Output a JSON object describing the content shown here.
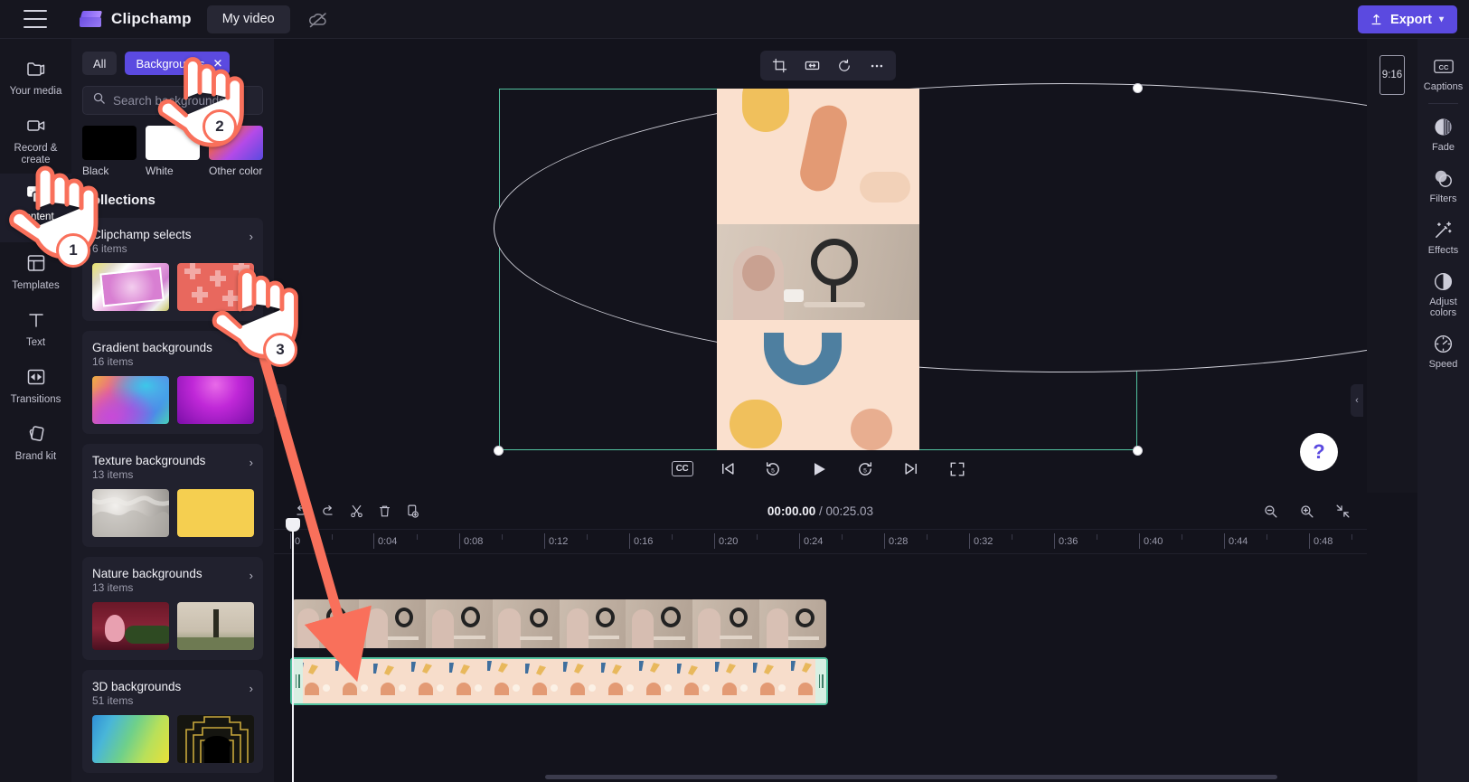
{
  "topbar": {
    "menu_icon": "hamburger-menu-icon",
    "logo_icon": "clipchamp-logo-icon",
    "app_name": "Clipchamp",
    "project_name": "My video",
    "cloud_icon": "cloud-offline-icon",
    "export_label": "Export",
    "export_caret": "⌄",
    "accent_color": "#5b4ae0"
  },
  "left_rail": {
    "items": [
      {
        "label": "Your media",
        "icon": "folder-icon",
        "active": false
      },
      {
        "label": "Record & create",
        "icon": "video-camera-icon",
        "active": false
      },
      {
        "label": "Content library",
        "icon": "content-library-icon",
        "active": true
      },
      {
        "label": "Templates",
        "icon": "templates-icon",
        "active": false
      },
      {
        "label": "Text",
        "icon": "text-icon",
        "active": false
      },
      {
        "label": "Transitions",
        "icon": "transitions-icon",
        "active": false
      },
      {
        "label": "Brand kit",
        "icon": "brand-kit-icon",
        "active": false
      }
    ]
  },
  "library_panel": {
    "filter_chips": [
      {
        "label": "All",
        "selected": false
      },
      {
        "label": "Backgrounds",
        "selected": true,
        "close_icon": "✕"
      }
    ],
    "search": {
      "icon": "search-icon",
      "placeholder": "Search backgrounds",
      "value": ""
    },
    "color_swatches": [
      {
        "label": "Black",
        "color": "#000000"
      },
      {
        "label": "White",
        "color": "#ffffff"
      },
      {
        "label": "Other color",
        "color": "gradient"
      }
    ],
    "collections_heading": "Collections",
    "collections": [
      {
        "title": "Clipchamp selects",
        "count": "6 items",
        "chevron": "›"
      },
      {
        "title": "Gradient backgrounds",
        "count": "16 items",
        "chevron": "›"
      },
      {
        "title": "Texture backgrounds",
        "count": "13 items",
        "chevron": "›"
      },
      {
        "title": "Nature backgrounds",
        "count": "13 items",
        "chevron": "›"
      },
      {
        "title": "3D backgrounds",
        "count": "51 items",
        "chevron": "›"
      }
    ],
    "collapse_icon": "‹"
  },
  "stage": {
    "float_tools": [
      {
        "icon": "crop-icon"
      },
      {
        "icon": "fit-to-frame-icon"
      },
      {
        "icon": "rotate-icon"
      },
      {
        "icon": "more-options-icon"
      }
    ],
    "selection_color": "#52c3a0",
    "player_controls": [
      {
        "icon": "captions-cc-icon",
        "label": "CC"
      },
      {
        "icon": "skip-previous-icon"
      },
      {
        "icon": "rewind-5-icon"
      },
      {
        "icon": "play-icon"
      },
      {
        "icon": "forward-5-icon"
      },
      {
        "icon": "skip-next-icon"
      },
      {
        "icon": "fullscreen-icon"
      }
    ],
    "aspect_ratio": "9:16",
    "help_label": "?",
    "collapse_icon": "‹"
  },
  "tools_rail": {
    "items": [
      {
        "label": "Captions",
        "icon": "captions-cc-icon"
      },
      {
        "label": "Fade",
        "icon": "fade-icon"
      },
      {
        "label": "Filters",
        "icon": "filters-icon"
      },
      {
        "label": "Effects",
        "icon": "effects-wand-icon"
      },
      {
        "label": "Adjust colors",
        "icon": "adjust-colors-icon"
      },
      {
        "label": "Speed",
        "icon": "speed-gauge-icon"
      }
    ]
  },
  "timeline": {
    "toolbar": [
      {
        "icon": "undo-icon"
      },
      {
        "icon": "redo-icon"
      },
      {
        "icon": "split-scissors-icon"
      },
      {
        "icon": "delete-trash-icon"
      },
      {
        "icon": "duplicate-icon"
      }
    ],
    "current_time": "00:00.00",
    "separator": "/",
    "total_time": "00:25.03",
    "zoom_out_icon": "zoom-out-icon",
    "zoom_in_icon": "zoom-in-icon",
    "fit_icon": "fit-timeline-icon",
    "ruler_ticks": [
      "0",
      "0:04",
      "0:08",
      "0:12",
      "0:16",
      "0:20",
      "0:24",
      "0:28",
      "0:32",
      "0:36",
      "0:40",
      "0:44",
      "0:48"
    ],
    "tracks": [
      {
        "name": "video-clip",
        "selected": false
      },
      {
        "name": "background-clip",
        "selected": true
      }
    ]
  },
  "annotations": {
    "steps": [
      {
        "number": "1",
        "target": "content-library-rail-item"
      },
      {
        "number": "2",
        "target": "backgrounds-filter-chip"
      },
      {
        "number": "3",
        "target": "clipchamp-selects-thumbnail"
      }
    ],
    "arrow_color": "#f9705b"
  }
}
